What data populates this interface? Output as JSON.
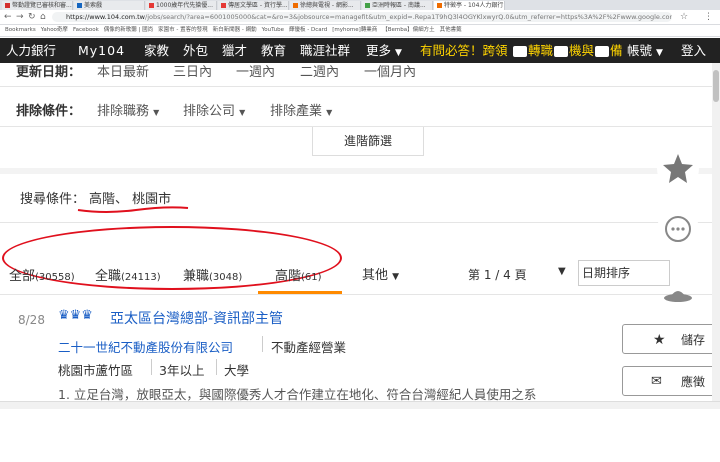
{
  "browser": {
    "tabs": [
      {
        "label": "幣勤證覽已審核和審...",
        "color": "#d32f2f"
      },
      {
        "label": "美索戲",
        "color": "#1565c0"
      },
      {
        "label": "1000歲年代先搶優...",
        "color": "#e53935"
      },
      {
        "label": "傳居文學區 - 資行學...",
        "color": "#e53935"
      },
      {
        "label": "徐總與電視 - 網影...",
        "color": "#ef6c00"
      },
      {
        "label": "亞洲時報區 - 南議...",
        "color": "#43a047"
      },
      {
        "label": "特徵亭 - 104人力銀行...",
        "color": "#ef6c00"
      }
    ],
    "url_host": "https://www.104.com.tw",
    "url_path": "/jobs/search/?area=6001005000&cat=&ro=3&jobsource=managefit&utm_expid=.Repa1T9hQ3l4OGYKlxwyrQ.0&utm_referrer=https%3A%2F%2Fwww.google.com.tw%2F",
    "bookmarks": [
      "Bookmarks",
      "Yahoo奇摩",
      "Facebook",
      "偶像的新歌聽 | 國尚",
      "家園市 - 置客的發現",
      "新白新聞器 - 網動",
      "YouTube",
      "輝優板 - Dcard",
      "[myhome]轉業商",
      "【Bemba】偏細方土",
      "其他書籤"
    ]
  },
  "site_nav": {
    "brand": "人力銀行",
    "items": [
      "My104",
      "家教",
      "外包",
      "獵才",
      "教育",
      "職涯社群",
      "更多"
    ],
    "promo": "有問必答！跨領",
    "promo_items": [
      "轉職",
      "機與",
      "備"
    ],
    "account": "帳號",
    "login": "登入"
  },
  "filters": {
    "update_label": "更新日期：",
    "update_options": [
      "本日最新",
      "三日內",
      "一週內",
      "二週內",
      "一個月內"
    ],
    "exclude_label": "排除條件：",
    "exclude_options": [
      "排除職務",
      "排除公司",
      "排除產業"
    ],
    "advanced": "進階篩選",
    "search_label": "搜尋條件：",
    "search_terms": "高階、 桃園市"
  },
  "result_tabs": [
    {
      "label": "全部",
      "count": "(30558)"
    },
    {
      "label": "全職",
      "count": "(24113)"
    },
    {
      "label": "兼職",
      "count": "(3048)"
    },
    {
      "label": "高階",
      "count": "(61)"
    }
  ],
  "other_label": "其他",
  "pagination": "第 1 / 4 頁",
  "sort_label": "日期排序",
  "job": {
    "date": "8/28",
    "crowns": "♛♛♛",
    "title": "亞太區台灣總部-資訊部主管",
    "company": "二十一世紀不動產股份有限公司",
    "industry": "不動產經營業",
    "location": "桃園市蘆竹區",
    "experience": "3年以上",
    "education": "大學",
    "description": "1. 立足台灣，放眼亞太，與國際優秀人才合作建立在地化、符合台灣經紀人員使用之系"
  },
  "side_actions": {
    "save": "儲存",
    "apply": "應徵"
  },
  "colors": {
    "accent": "#ff8a00",
    "annotation": "#e0101d",
    "link": "#1a5ec5"
  }
}
